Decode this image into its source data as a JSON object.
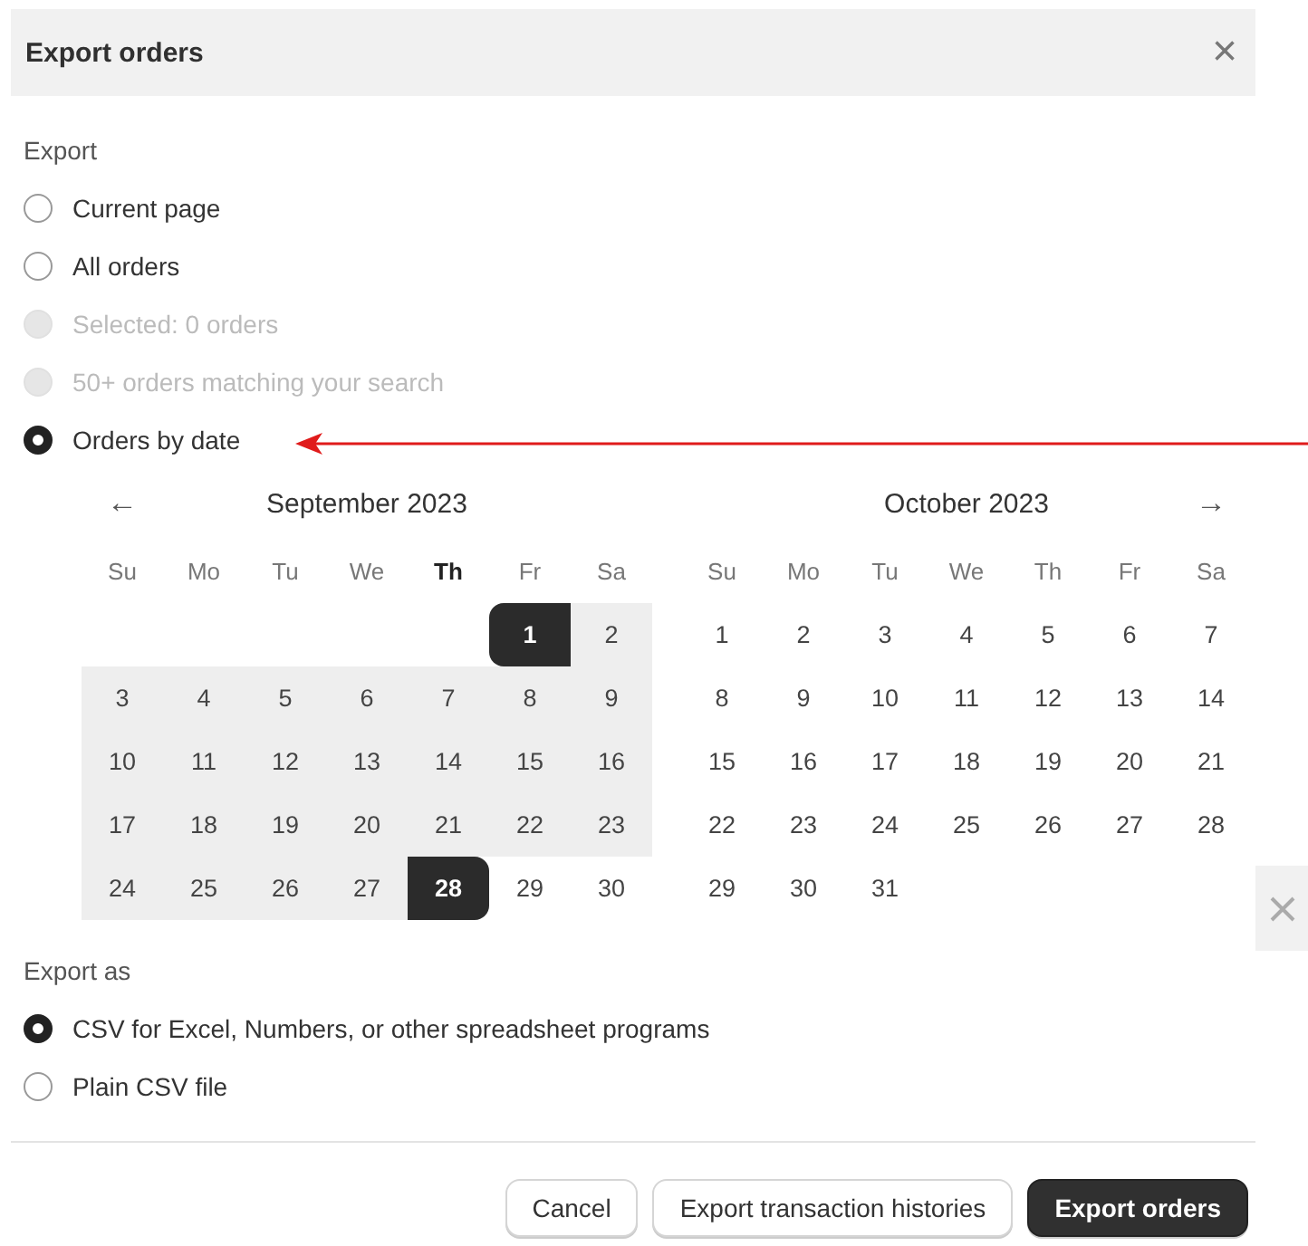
{
  "dialog": {
    "title": "Export orders",
    "close": "×"
  },
  "export": {
    "label": "Export",
    "options": [
      {
        "label": "Current page",
        "selected": false,
        "disabled": false
      },
      {
        "label": "All orders",
        "selected": false,
        "disabled": false
      },
      {
        "label": "Selected: 0 orders",
        "selected": false,
        "disabled": true
      },
      {
        "label": "50+ orders matching your search",
        "selected": false,
        "disabled": true
      },
      {
        "label": "Orders by date",
        "selected": true,
        "disabled": false
      }
    ]
  },
  "pointer_arrow": true,
  "calendar": {
    "prev": "←",
    "next": "→",
    "months": [
      {
        "title": "September 2023",
        "weekdays": [
          {
            "label": "Su",
            "current": false
          },
          {
            "label": "Mo",
            "current": false
          },
          {
            "label": "Tu",
            "current": false
          },
          {
            "label": "We",
            "current": false
          },
          {
            "label": "Th",
            "current": true
          },
          {
            "label": "Fr",
            "current": false
          },
          {
            "label": "Sa",
            "current": false
          }
        ],
        "weeks": [
          [
            {
              "day": "1",
              "selected": true,
              "in_range": true
            },
            {
              "day": "2",
              "selected": false,
              "in_range": true
            }
          ],
          [
            {
              "day": "3",
              "selected": false,
              "in_range": true
            },
            {
              "day": "4",
              "selected": false,
              "in_range": true
            },
            {
              "day": "5",
              "selected": false,
              "in_range": true
            },
            {
              "day": "6",
              "selected": false,
              "in_range": true
            },
            {
              "day": "7",
              "selected": false,
              "in_range": true
            },
            {
              "day": "8",
              "selected": false,
              "in_range": true
            },
            {
              "day": "9",
              "selected": false,
              "in_range": true
            }
          ],
          [
            {
              "day": "10",
              "selected": false,
              "in_range": true
            },
            {
              "day": "11",
              "selected": false,
              "in_range": true
            },
            {
              "day": "12",
              "selected": false,
              "in_range": true
            },
            {
              "day": "13",
              "selected": false,
              "in_range": true
            },
            {
              "day": "14",
              "selected": false,
              "in_range": true
            },
            {
              "day": "15",
              "selected": false,
              "in_range": true
            },
            {
              "day": "16",
              "selected": false,
              "in_range": true
            }
          ],
          [
            {
              "day": "17",
              "selected": false,
              "in_range": true
            },
            {
              "day": "18",
              "selected": false,
              "in_range": true
            },
            {
              "day": "19",
              "selected": false,
              "in_range": true
            },
            {
              "day": "20",
              "selected": false,
              "in_range": true
            },
            {
              "day": "21",
              "selected": false,
              "in_range": true
            },
            {
              "day": "22",
              "selected": false,
              "in_range": true
            },
            {
              "day": "23",
              "selected": false,
              "in_range": true
            }
          ],
          [
            {
              "day": "24",
              "selected": false,
              "in_range": true
            },
            {
              "day": "25",
              "selected": false,
              "in_range": true
            },
            {
              "day": "26",
              "selected": false,
              "in_range": true
            },
            {
              "day": "27",
              "selected": false,
              "in_range": true
            },
            {
              "day": "28",
              "selected": true,
              "in_range": true
            },
            {
              "day": "29",
              "selected": false,
              "in_range": false
            },
            {
              "day": "30",
              "selected": false,
              "in_range": false
            }
          ]
        ]
      },
      {
        "title": "October 2023",
        "weekdays": [
          {
            "label": "Su",
            "current": false
          },
          {
            "label": "Mo",
            "current": false
          },
          {
            "label": "Tu",
            "current": false
          },
          {
            "label": "We",
            "current": false
          },
          {
            "label": "Th",
            "current": false
          },
          {
            "label": "Fr",
            "current": false
          },
          {
            "label": "Sa",
            "current": false
          }
        ],
        "weeks": [
          [
            {
              "day": "1",
              "selected": false,
              "in_range": false
            },
            {
              "day": "2",
              "selected": false,
              "in_range": false
            },
            {
              "day": "3",
              "selected": false,
              "in_range": false
            },
            {
              "day": "4",
              "selected": false,
              "in_range": false
            },
            {
              "day": "5",
              "selected": false,
              "in_range": false
            },
            {
              "day": "6",
              "selected": false,
              "in_range": false
            },
            {
              "day": "7",
              "selected": false,
              "in_range": false
            }
          ],
          [
            {
              "day": "8",
              "selected": false,
              "in_range": false
            },
            {
              "day": "9",
              "selected": false,
              "in_range": false
            },
            {
              "day": "10",
              "selected": false,
              "in_range": false
            },
            {
              "day": "11",
              "selected": false,
              "in_range": false
            },
            {
              "day": "12",
              "selected": false,
              "in_range": false
            },
            {
              "day": "13",
              "selected": false,
              "in_range": false
            },
            {
              "day": "14",
              "selected": false,
              "in_range": false
            }
          ],
          [
            {
              "day": "15",
              "selected": false,
              "in_range": false
            },
            {
              "day": "16",
              "selected": false,
              "in_range": false
            },
            {
              "day": "17",
              "selected": false,
              "in_range": false
            },
            {
              "day": "18",
              "selected": false,
              "in_range": false
            },
            {
              "day": "19",
              "selected": false,
              "in_range": false
            },
            {
              "day": "20",
              "selected": false,
              "in_range": false
            },
            {
              "day": "21",
              "selected": false,
              "in_range": false
            }
          ],
          [
            {
              "day": "22",
              "selected": false,
              "in_range": false
            },
            {
              "day": "23",
              "selected": false,
              "in_range": false
            },
            {
              "day": "24",
              "selected": false,
              "in_range": false
            },
            {
              "day": "25",
              "selected": false,
              "in_range": false
            },
            {
              "day": "26",
              "selected": false,
              "in_range": false
            },
            {
              "day": "27",
              "selected": false,
              "in_range": false
            },
            {
              "day": "28",
              "selected": false,
              "in_range": false
            }
          ],
          [
            {
              "day": "29",
              "selected": false,
              "in_range": false
            },
            {
              "day": "30",
              "selected": false,
              "in_range": false
            },
            {
              "day": "31",
              "selected": false,
              "in_range": false
            }
          ]
        ]
      }
    ]
  },
  "export_as": {
    "label": "Export as",
    "options": [
      {
        "label": "CSV for Excel, Numbers, or other spreadsheet programs",
        "selected": true,
        "disabled": false
      },
      {
        "label": "Plain CSV file",
        "selected": false,
        "disabled": false
      }
    ]
  },
  "side_close": true,
  "buttons": [
    {
      "label": "Cancel",
      "kind": "secondary"
    },
    {
      "label": "Export transaction histories",
      "kind": "secondary"
    },
    {
      "label": "Export orders",
      "kind": "primary"
    }
  ]
}
